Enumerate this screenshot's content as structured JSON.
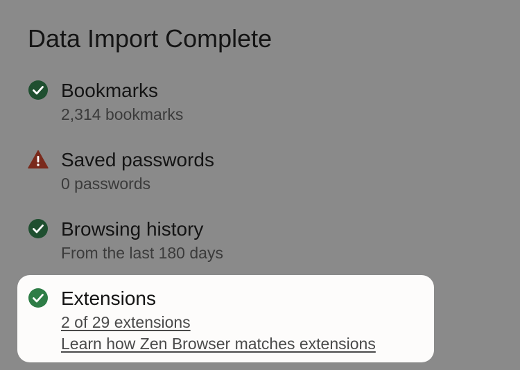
{
  "title": "Data Import Complete",
  "colors": {
    "overlay_background": "#8a8a8a",
    "success_icon": "#1f4f30",
    "success_icon_highlighted": "#2e7d46",
    "warning_icon": "#7a2a1c",
    "card_background": "#fdfcfb"
  },
  "items": [
    {
      "title": "Bookmarks",
      "detail": "2,314 bookmarks",
      "status": "success",
      "icon": "check-circle-icon"
    },
    {
      "title": "Saved passwords",
      "detail": "0 passwords",
      "status": "warning",
      "icon": "warning-triangle-icon"
    },
    {
      "title": "Browsing history",
      "detail": "From the last 180 days",
      "status": "success",
      "icon": "check-circle-icon"
    },
    {
      "title": "Extensions",
      "detail_link": "2 of 29 extensions",
      "help_link": "Learn how Zen Browser matches extensions",
      "status": "success",
      "icon": "check-circle-icon",
      "highlighted": true
    }
  ]
}
